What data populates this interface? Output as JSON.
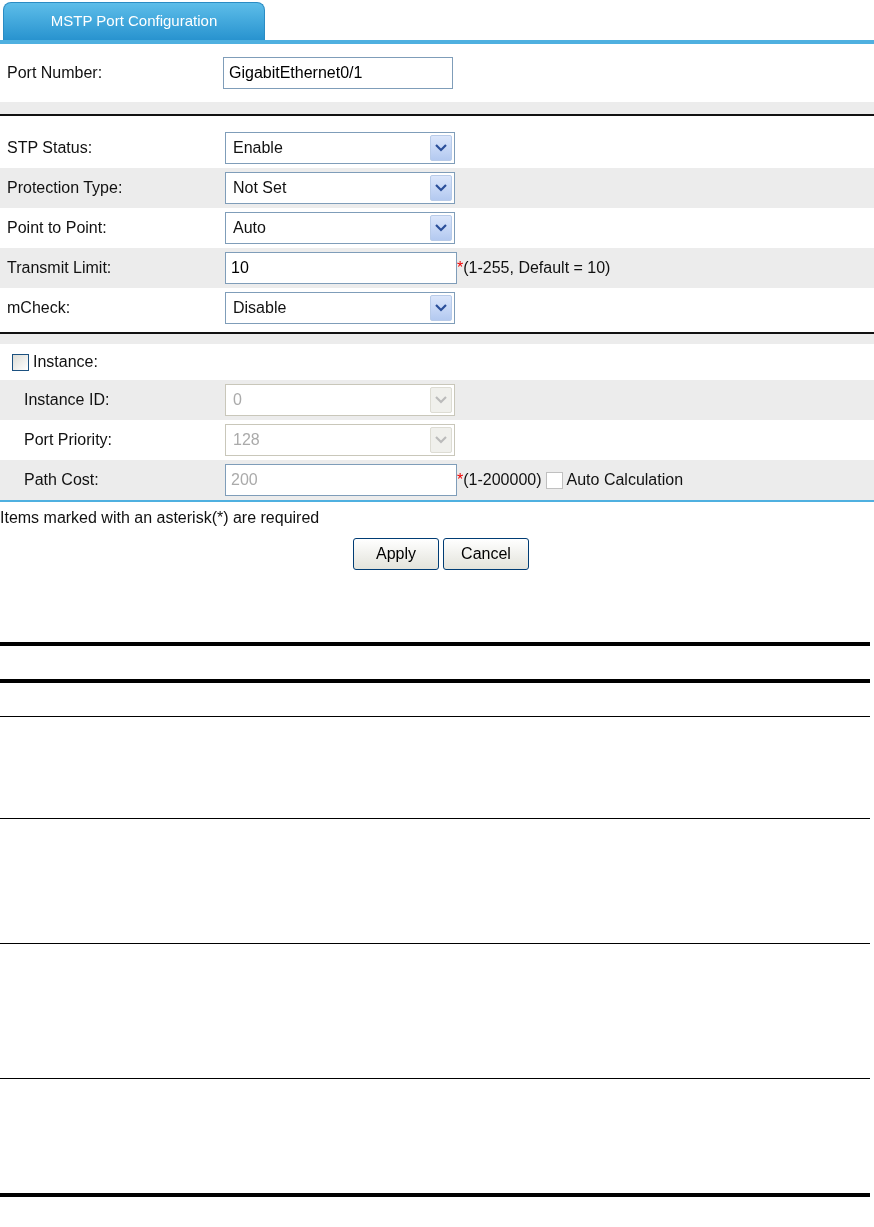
{
  "tab": {
    "label": "MSTP Port Configuration",
    "selected": true
  },
  "port_number": {
    "label": "Port Number:",
    "value": "GigabitEthernet0/1"
  },
  "settings": [
    {
      "label": "STP Status:",
      "kind": "select",
      "value": "Enable"
    },
    {
      "label": "Protection Type:",
      "kind": "select",
      "value": "Not Set"
    },
    {
      "label": "Point to Point:",
      "kind": "select",
      "value": "Auto"
    },
    {
      "label": "Transmit Limit:",
      "kind": "input",
      "value": "10",
      "required_mark": "*",
      "hint": "(1-255, Default = 10)"
    },
    {
      "label": "mCheck:",
      "kind": "select",
      "value": "Disable"
    }
  ],
  "instance": {
    "label": "Instance:",
    "checked": false,
    "fields": [
      {
        "label": "Instance ID:",
        "kind": "select",
        "value": "0",
        "disabled": true
      },
      {
        "label": "Port Priority:",
        "kind": "select",
        "value": "128",
        "disabled": true
      },
      {
        "label": "Path Cost:",
        "kind": "input",
        "value": "200",
        "disabled": true,
        "required_mark": "*",
        "hint": "(1-200000)",
        "auto_calculation": {
          "label": "Auto Calculation",
          "checked": false
        }
      }
    ]
  },
  "note": "Items marked with an asterisk(*) are required",
  "buttons": [
    "Apply",
    "Cancel"
  ]
}
